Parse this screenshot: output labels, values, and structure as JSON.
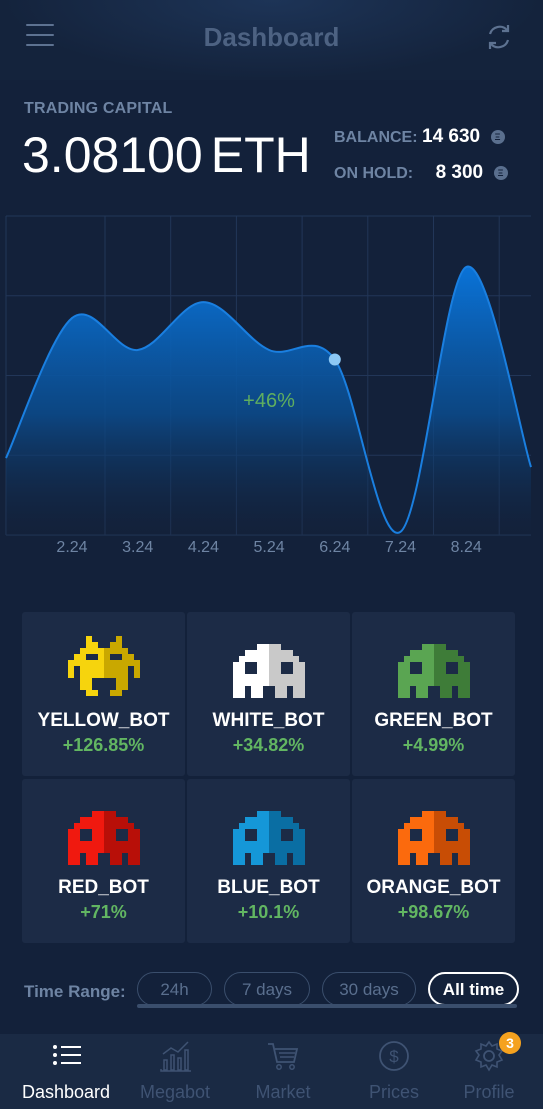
{
  "header": {
    "title": "Dashboard"
  },
  "capital": {
    "label": "TRADING CAPITAL",
    "value": "3.08100",
    "unit": "ETH",
    "balance_label": "BALANCE:",
    "balance_value": "14 630",
    "on_hold_label": "ON HOLD:",
    "on_hold_value": "8 300",
    "coin_symbol": "Ξ"
  },
  "chart_data": {
    "type": "area",
    "categories": [
      "2.24",
      "3.24",
      "4.24",
      "5.24",
      "6.24",
      "7.24",
      "8.24"
    ],
    "values": [
      68,
      58,
      73,
      58,
      55,
      1,
      84
    ],
    "highlighted_point": "6.24",
    "annotation": "+46%",
    "ylim": [
      0,
      100
    ],
    "grid": true,
    "color": "#0a6fd1"
  },
  "bots": [
    {
      "name": "YELLOW_BOT",
      "change": "+126.85%",
      "color": "#f6d40d",
      "shade": "#c9a800",
      "icon": "invader-antenna-icon"
    },
    {
      "name": "WHITE_BOT",
      "change": "+34.82%",
      "color": "#ffffff",
      "shade": "#c9c9c9",
      "icon": "ghost-invader-icon"
    },
    {
      "name": "GREEN_BOT",
      "change": "+4.99%",
      "color": "#5aa552",
      "shade": "#3e7c38",
      "icon": "ghost-invader-icon"
    },
    {
      "name": "RED_BOT",
      "change": "+71%",
      "color": "#f0190f",
      "shade": "#b80f08",
      "icon": "ghost-invader-icon"
    },
    {
      "name": "BLUE_BOT",
      "change": "+10.1%",
      "color": "#1597d8",
      "shade": "#0a6ea3",
      "icon": "ghost-invader-icon"
    },
    {
      "name": "ORANGE_BOT",
      "change": "+98.67%",
      "color": "#fb6a0d",
      "shade": "#c84d05",
      "icon": "ghost-invader-icon"
    }
  ],
  "time_range": {
    "label": "Time Range:",
    "options": [
      "24h",
      "7 days",
      "30 days",
      "All time"
    ],
    "selected": "All time"
  },
  "nav": {
    "items": [
      {
        "label": "Dashboard",
        "icon": "list-icon",
        "active": true
      },
      {
        "label": "Megabot",
        "icon": "chart-icon",
        "active": false
      },
      {
        "label": "Market",
        "icon": "cart-icon",
        "active": false
      },
      {
        "label": "Prices",
        "icon": "dollar-icon",
        "active": false
      },
      {
        "label": "Profile",
        "icon": "gear-icon",
        "active": false
      }
    ],
    "profile_badge": "3"
  }
}
